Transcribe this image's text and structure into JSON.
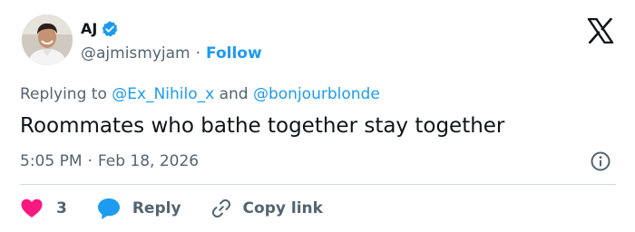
{
  "author": {
    "display_name": "AJ",
    "handle": "@ajmismyjam",
    "follow_label": "Follow",
    "verified_color": "#1d9bf0"
  },
  "platform_icon": "x-logo-icon",
  "replying": {
    "prefix": "Replying to",
    "user1": "@Ex_Nihilo_x",
    "joiner": "and",
    "user2": "@bonjourblonde"
  },
  "tweet": {
    "text": "Roommates who bathe together stay together",
    "time": "5:05 PM",
    "separator": "·",
    "date": "Feb 18, 2026"
  },
  "actions": {
    "like_count": "3",
    "reply_label": "Reply",
    "copy_label": "Copy link"
  },
  "colors": {
    "accent": "#1d9bf0",
    "like": "#f91880",
    "muted": "#536471",
    "text": "#0f1419"
  }
}
